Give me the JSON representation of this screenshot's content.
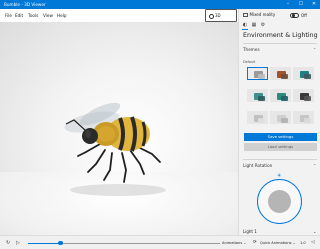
{
  "window": {
    "title": "Bumble - 3D Viewer",
    "minimize": "–",
    "maximize": "☐",
    "close": "✕"
  },
  "menu": [
    "File",
    "Edit",
    "Tools",
    "View",
    "Help"
  ],
  "history_button": "3D History",
  "right_panel": {
    "mixed_reality": "Mixed reality",
    "toggle_label": "Off",
    "title": "Environment & Lighting",
    "themes": {
      "heading": "Themes",
      "sub": "Default",
      "save": "Save settings",
      "load": "Load settings"
    },
    "light_rotation": "Light Rotation",
    "light1": "Light 1"
  },
  "bottom": {
    "animations": "Animations ⌄",
    "quick_animations": "Quick Animations ⌄",
    "zoom": "1.0"
  },
  "colors": {
    "accent": "#0078d7",
    "titlebar": "#0078d7",
    "panel": "#f2f2f2"
  },
  "icons": [
    "history-icon",
    "tab-environment-icon",
    "tab-stats-icon",
    "tab-settings-icon",
    "sun-icon",
    "loop-icon",
    "play-icon",
    "rotate-icon",
    "sound-icon"
  ]
}
